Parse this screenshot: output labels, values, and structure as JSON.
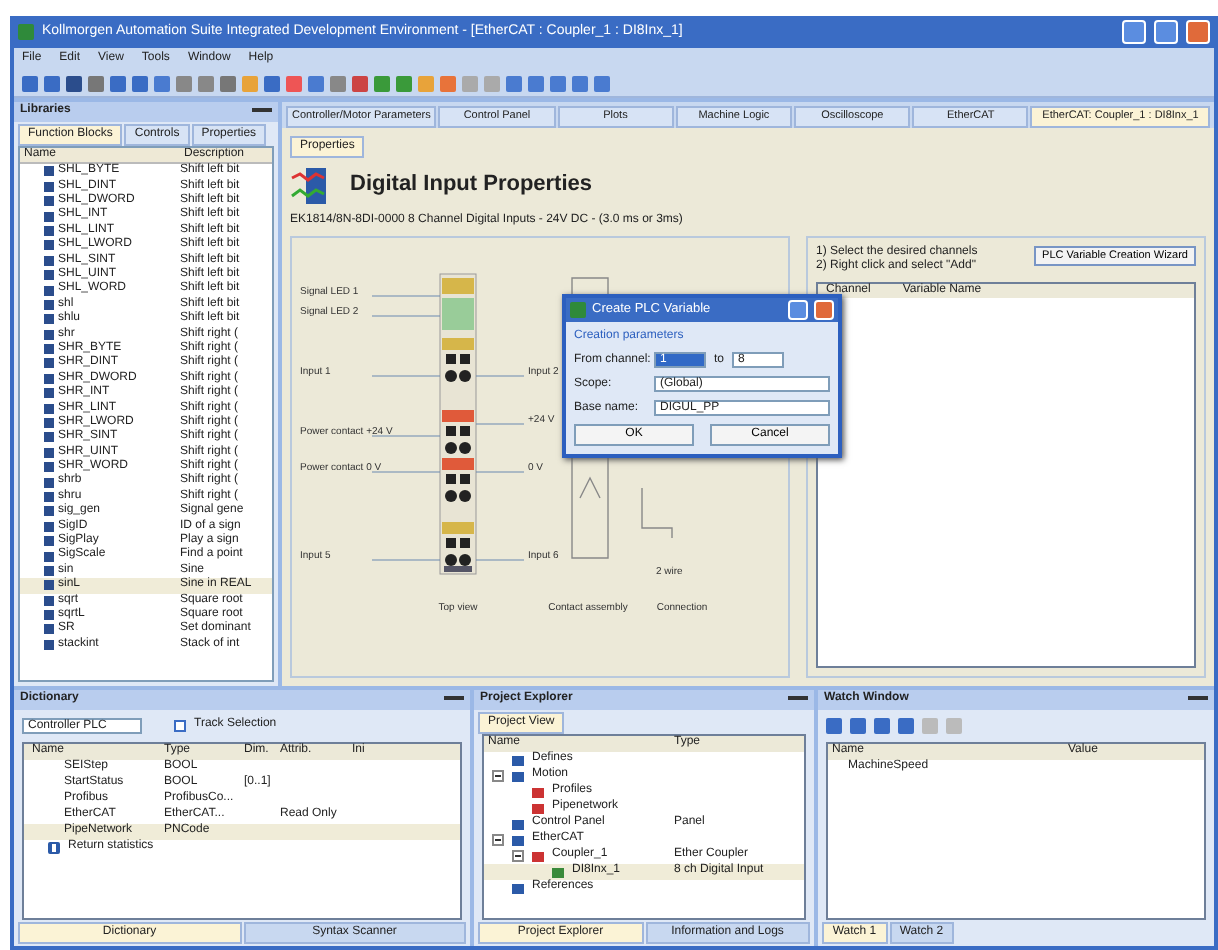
{
  "window": {
    "title": "Kollmorgen Automation Suite Integrated Development Environment - [EtherCAT : Coupler_1 : DI8Inx_1]"
  },
  "menu": [
    "File",
    "Edit",
    "View",
    "Tools",
    "Window",
    "Help"
  ],
  "library": {
    "title": "Libraries",
    "tabs": [
      {
        "label": "Function Blocks",
        "selected": true
      },
      {
        "label": "Controls",
        "selected": false
      },
      {
        "label": "Properties",
        "selected": false
      }
    ],
    "columns": [
      "Name",
      "Description"
    ],
    "rows": [
      {
        "name": "SHL_BYTE",
        "description": "Shift left bit",
        "selected": false
      },
      {
        "name": "SHL_DINT",
        "description": "Shift left bit",
        "selected": false
      },
      {
        "name": "SHL_DWORD",
        "description": "Shift left bit",
        "selected": false
      },
      {
        "name": "SHL_INT",
        "description": "Shift left bit",
        "selected": false
      },
      {
        "name": "SHL_LINT",
        "description": "Shift left bit",
        "selected": false
      },
      {
        "name": "SHL_LWORD",
        "description": "Shift left bit",
        "selected": false
      },
      {
        "name": "SHL_SINT",
        "description": "Shift left bit",
        "selected": false
      },
      {
        "name": "SHL_UINT",
        "description": "Shift left bit",
        "selected": false
      },
      {
        "name": "SHL_WORD",
        "description": "Shift left bit",
        "selected": false
      },
      {
        "name": "shl",
        "description": "Shift left bit",
        "selected": false
      },
      {
        "name": "shlu",
        "description": "Shift left bit",
        "selected": false
      },
      {
        "name": "shr",
        "description": "Shift right (",
        "selected": false
      },
      {
        "name": "SHR_BYTE",
        "description": "Shift right (",
        "selected": false
      },
      {
        "name": "SHR_DINT",
        "description": "Shift right (",
        "selected": false
      },
      {
        "name": "SHR_DWORD",
        "description": "Shift right (",
        "selected": false
      },
      {
        "name": "SHR_INT",
        "description": "Shift right (",
        "selected": false
      },
      {
        "name": "SHR_LINT",
        "description": "Shift right (",
        "selected": false
      },
      {
        "name": "SHR_LWORD",
        "description": "Shift right (",
        "selected": false
      },
      {
        "name": "SHR_SINT",
        "description": "Shift right (",
        "selected": false
      },
      {
        "name": "SHR_UINT",
        "description": "Shift right (",
        "selected": false
      },
      {
        "name": "SHR_WORD",
        "description": "Shift right (",
        "selected": false
      },
      {
        "name": "shrb",
        "description": "Shift right (",
        "selected": false
      },
      {
        "name": "shru",
        "description": "Shift right (",
        "selected": false
      },
      {
        "name": "sig_gen",
        "description": "Signal gene",
        "selected": false
      },
      {
        "name": "SigID",
        "description": "ID of a sign",
        "selected": false
      },
      {
        "name": "SigPlay",
        "description": "Play a sign",
        "selected": false
      },
      {
        "name": "SigScale",
        "description": "Find a point",
        "selected": false
      },
      {
        "name": "sin",
        "description": "Sine",
        "selected": false
      },
      {
        "name": "sinL",
        "description": "Sine in REAL",
        "selected": true
      },
      {
        "name": "sqrt",
        "description": "Square root",
        "selected": false
      },
      {
        "name": "sqrtL",
        "description": "Square root",
        "selected": false
      },
      {
        "name": "SR",
        "description": "Set dominant",
        "selected": false
      },
      {
        "name": "stackint",
        "description": "Stack of int",
        "selected": false
      }
    ]
  },
  "doc_tabs": [
    {
      "label": "Controller/Motor Parameters",
      "selected": false
    },
    {
      "label": "Control Panel",
      "selected": false
    },
    {
      "label": "Plots",
      "selected": false
    },
    {
      "label": "Machine Logic",
      "selected": false
    },
    {
      "label": "Oscilloscope",
      "selected": false
    },
    {
      "label": "EtherCAT",
      "selected": false
    },
    {
      "label": "EtherCAT: Coupler_1 : DI8Inx_1",
      "selected": true
    }
  ],
  "properties": {
    "tab": "Properties",
    "heading": "Digital Input Properties",
    "subtitle": "EK1814/8N-8DI-0000 8 Channel Digital Inputs - 24V DC - (3.0 ms or 3ms)",
    "left_labels": [
      "Signal LED 1",
      "Signal LED 2",
      "Input 1",
      "Power contact +24 V",
      "Power contact 0 V",
      "Input 5"
    ],
    "right_labels": [
      "Input 2",
      "+24 V",
      "0 V",
      "Input 6"
    ],
    "captions": [
      "Top view",
      "Contact assembly",
      "Connection"
    ],
    "wire_label": "2 wire"
  },
  "channels_panel": {
    "steps": [
      "1) Select the desired channels",
      "2) Right click and select \"Add\""
    ],
    "wizard_button": "PLC Variable Creation Wizard",
    "columns": [
      "Channel",
      "Variable Name"
    ]
  },
  "dialog": {
    "title": "Create PLC Variable",
    "group": "Creation parameters",
    "from_label": "From channel:",
    "from_value": "1",
    "to_label": "to",
    "to_value": "8",
    "scope_label": "Scope:",
    "scope_value": "(Global)",
    "base_label": "Base name:",
    "base_value": "DIGUL_PP",
    "buttons": [
      "OK",
      "Cancel"
    ]
  },
  "dictionary": {
    "title": "Dictionary",
    "filter": "Controller PLC",
    "track_selection": {
      "label": "Track Selection",
      "checked": false
    },
    "columns": [
      "Name",
      "Type",
      "Dim.",
      "Attrib.",
      "Ini"
    ],
    "rows": [
      {
        "name": "SEIStep",
        "type": "BOOL",
        "selected": false
      },
      {
        "name": "StartStatus",
        "type": "BOOL",
        "dim": "[0..1]",
        "selected": false
      },
      {
        "name": "Profibus",
        "type": "ProfibusCo...",
        "selected": false
      },
      {
        "name": "EtherCAT",
        "type": "EtherCAT...",
        "attrib": "Read Only",
        "selected": false
      },
      {
        "name": "PipeNetwork",
        "type": "PNCode",
        "selected": true
      }
    ],
    "group_row": "Return statistics",
    "tabs": [
      {
        "label": "Dictionary",
        "selected": true
      },
      {
        "label": "Syntax Scanner",
        "selected": false
      }
    ]
  },
  "project_explorer": {
    "title": "Project Explorer",
    "view_tab": "Project View",
    "columns": [
      "Name",
      "Type"
    ],
    "tree": [
      {
        "name": "Defines",
        "selected": false
      },
      {
        "name": "Motion",
        "expanded": true,
        "selected": false,
        "children": [
          {
            "name": "Profiles",
            "selected": false
          },
          {
            "name": "Pipenetwork",
            "selected": false
          }
        ]
      },
      {
        "name": "Control Panel",
        "type": "Panel",
        "selected": false
      },
      {
        "name": "EtherCAT",
        "expanded": true,
        "selected": false,
        "children": [
          {
            "name": "Coupler_1",
            "type": "Ether Coupler",
            "expanded": true,
            "selected": false,
            "children": [
              {
                "name": "DI8Inx_1",
                "type": "8 ch Digital Input",
                "selected": true
              }
            ]
          }
        ]
      },
      {
        "name": "References",
        "selected": false
      }
    ],
    "tabs": [
      {
        "label": "Project Explorer",
        "selected": true
      },
      {
        "label": "Information and Logs",
        "selected": false
      }
    ]
  },
  "watch": {
    "title": "Watch Window",
    "columns": [
      "Name",
      "Value"
    ],
    "rows": [
      {
        "name": "MachineSpeed"
      }
    ],
    "tabs": [
      {
        "label": "Watch 1",
        "selected": true
      },
      {
        "label": "Watch 2",
        "selected": false
      }
    ]
  }
}
